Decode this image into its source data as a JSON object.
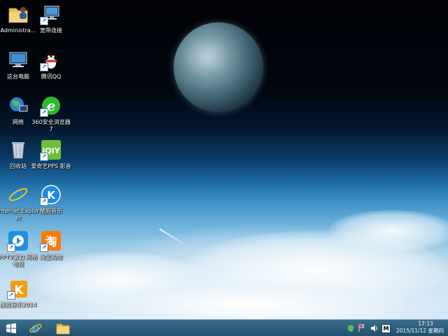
{
  "desktop": {
    "icons": [
      {
        "name": "administrator-folder",
        "label": "Administra..."
      },
      {
        "name": "broadband-connection",
        "label": "宽带连接"
      },
      {
        "name": "this-pc",
        "label": "这台电脑"
      },
      {
        "name": "tencent-qq",
        "label": "腾讯QQ"
      },
      {
        "name": "network",
        "label": "网络"
      },
      {
        "name": "360-browser",
        "label": "360安全浏览器7"
      },
      {
        "name": "recycle-bin",
        "label": "回收站"
      },
      {
        "name": "iqiyi-pps",
        "label": "爱奇艺PPS 影音"
      },
      {
        "name": "internet-explorer",
        "label": "Internet Explorer"
      },
      {
        "name": "kugou-music",
        "label": "酷狗音乐"
      },
      {
        "name": "pptv",
        "label": "PPTV聚力 网络电视"
      },
      {
        "name": "taobao",
        "label": "淘宝购物"
      },
      {
        "name": "kuwo-music",
        "label": "酷我音乐2014"
      }
    ]
  },
  "taskbar": {
    "pinned": [
      {
        "name": "start",
        "icon": "windows-logo-icon"
      },
      {
        "name": "internet-explorer",
        "icon": "ie-icon"
      },
      {
        "name": "file-explorer",
        "icon": "folder-icon"
      }
    ],
    "tray": {
      "ime_label": "M",
      "time": "17:13",
      "date": "2015/11/12 星期四"
    }
  }
}
